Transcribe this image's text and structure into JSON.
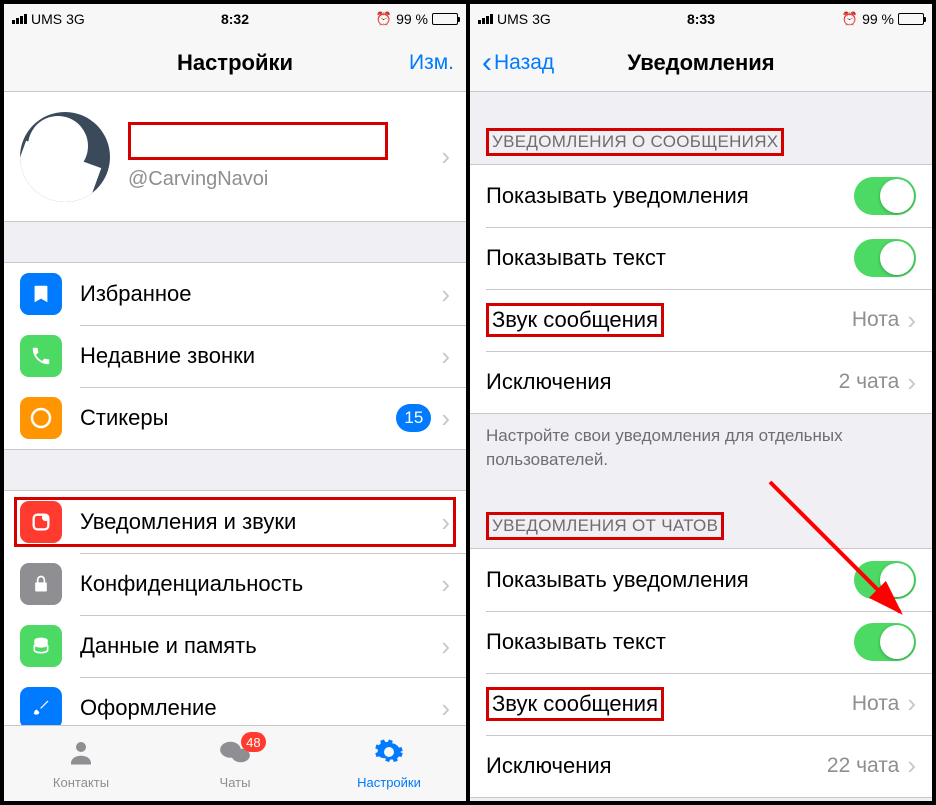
{
  "left": {
    "status": {
      "carrier": "UMS",
      "network": "3G",
      "time": "8:32",
      "battery_pct": "99 %"
    },
    "nav": {
      "title": "Настройки",
      "right": "Изм."
    },
    "profile": {
      "username": "@CarvingNavoi"
    },
    "group1": {
      "favorites": "Избранное",
      "recent": "Недавние звонки",
      "stickers": "Стикеры",
      "stickers_badge": "15"
    },
    "group2": {
      "notifications": "Уведомления и звуки",
      "privacy": "Конфиденциальность",
      "data": "Данные и память",
      "appearance": "Оформление"
    },
    "tabs": {
      "contacts": "Контакты",
      "chats": "Чаты",
      "chats_badge": "48",
      "settings": "Настройки"
    }
  },
  "right": {
    "status": {
      "carrier": "UMS",
      "network": "3G",
      "time": "8:33",
      "battery_pct": "99 %"
    },
    "nav": {
      "back": "Назад",
      "title": "Уведомления"
    },
    "sec1": {
      "header": "УВЕДОМЛЕНИЯ О СООБЩЕНИЯХ",
      "show_notif": "Показывать уведомления",
      "show_text": "Показывать текст",
      "sound": "Звук сообщения",
      "sound_value": "Нота",
      "exceptions": "Исключения",
      "exceptions_value": "2 чата"
    },
    "footer1": "Настройте свои уведомления для отдельных пользователей.",
    "sec2": {
      "header": "УВЕДОМЛЕНИЯ ОТ ЧАТОВ",
      "show_notif": "Показывать уведомления",
      "show_text": "Показывать текст",
      "sound": "Звук сообщения",
      "sound_value": "Нота",
      "exceptions": "Исключения",
      "exceptions_value": "22 чата"
    }
  }
}
